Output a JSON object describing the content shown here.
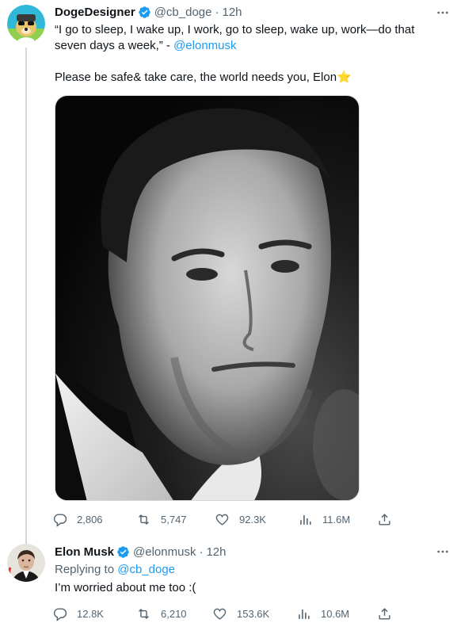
{
  "tweet1": {
    "name": "DogeDesigner",
    "handle": "@cb_doge",
    "dot": "·",
    "time": "12h",
    "line1": "“I go to sleep, I wake up, I work, go to sleep, wake up, work—do that",
    "line2_prefix": "seven days a week,” - ",
    "mention": "@elonmusk",
    "line3": "Please be safe& take care, the world needs you, Elon",
    "star_emoji": "⭐",
    "media_icon": "photo-portrait",
    "stats": {
      "replies": "2,806",
      "retweets": "5,747",
      "likes": "92.3K",
      "views": "11.6M"
    }
  },
  "tweet2": {
    "name": "Elon Musk",
    "handle": "@elonmusk",
    "dot": "·",
    "time": "12h",
    "replying_prefix": "Replying to ",
    "replying_to": "@cb_doge",
    "text": "I’m worried about me too :(",
    "stats": {
      "replies": "12.8K",
      "retweets": "6,210",
      "likes": "153.6K",
      "views": "10.6M"
    }
  },
  "colors": {
    "text": "#0f1419",
    "secondary": "#536471",
    "accent": "#1d9bf0",
    "border": "#cfd9de"
  },
  "icons": [
    "verified-badge-icon",
    "more-icon",
    "reply-icon",
    "retweet-icon",
    "like-icon",
    "views-icon",
    "share-icon"
  ]
}
